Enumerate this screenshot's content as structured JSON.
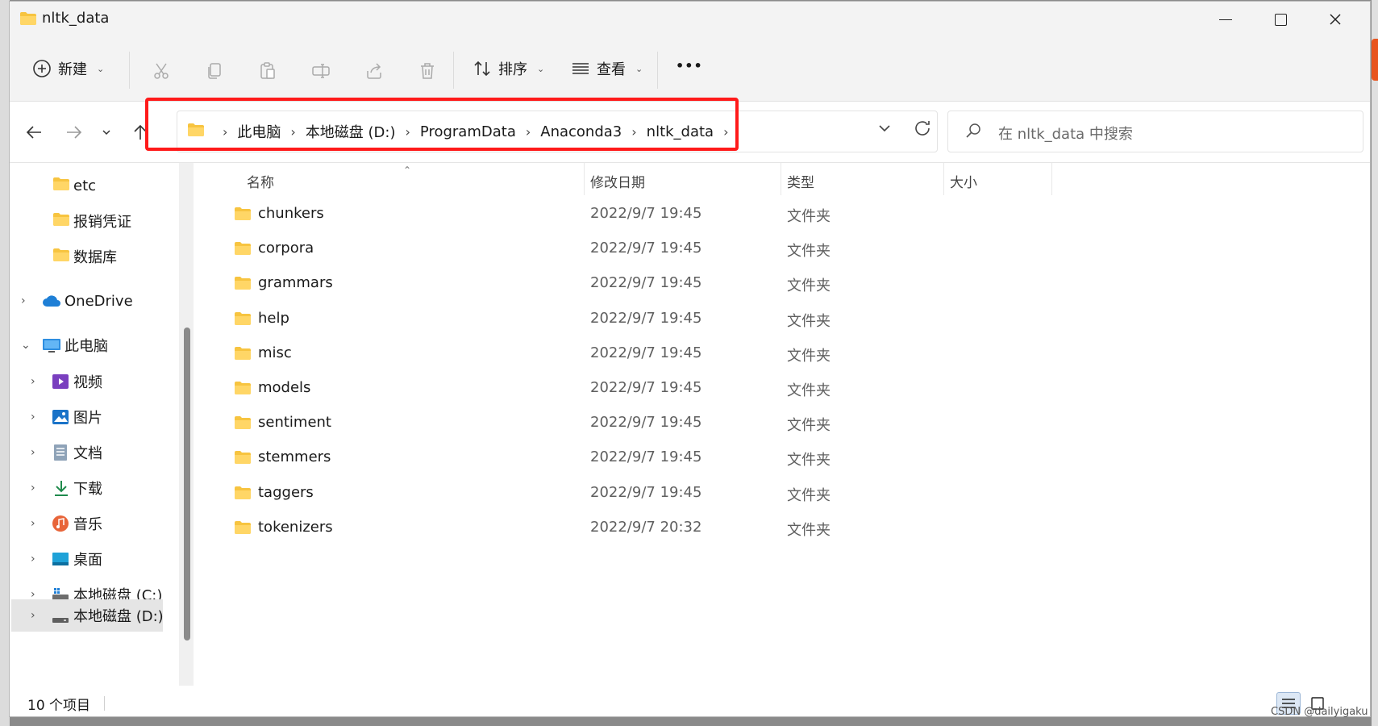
{
  "window": {
    "title": "nltk_data"
  },
  "toolbar": {
    "new_label": "新建",
    "sort_label": "排序",
    "view_label": "查看",
    "more_label": "•••"
  },
  "address": {
    "segments": [
      "此电脑",
      "本地磁盘 (D:)",
      "ProgramData",
      "Anaconda3",
      "nltk_data"
    ]
  },
  "search": {
    "placeholder": "在 nltk_data 中搜索"
  },
  "sidebar": {
    "items": [
      {
        "label": "etc"
      },
      {
        "label": "报销凭证"
      },
      {
        "label": "数据库"
      },
      {
        "label": "OneDrive"
      },
      {
        "label": "此电脑"
      },
      {
        "label": "视频"
      },
      {
        "label": "图片"
      },
      {
        "label": "文档"
      },
      {
        "label": "下载"
      },
      {
        "label": "音乐"
      },
      {
        "label": "桌面"
      },
      {
        "label": "本地磁盘 (C:)"
      },
      {
        "label": "本地磁盘 (D:)"
      }
    ]
  },
  "columns": {
    "name": "名称",
    "date": "修改日期",
    "type": "类型",
    "size": "大小"
  },
  "files": [
    {
      "name": "chunkers",
      "date": "2022/9/7 19:45",
      "type": "文件夹"
    },
    {
      "name": "corpora",
      "date": "2022/9/7 19:45",
      "type": "文件夹"
    },
    {
      "name": "grammars",
      "date": "2022/9/7 19:45",
      "type": "文件夹"
    },
    {
      "name": "help",
      "date": "2022/9/7 19:45",
      "type": "文件夹"
    },
    {
      "name": "misc",
      "date": "2022/9/7 19:45",
      "type": "文件夹"
    },
    {
      "name": "models",
      "date": "2022/9/7 19:45",
      "type": "文件夹"
    },
    {
      "name": "sentiment",
      "date": "2022/9/7 19:45",
      "type": "文件夹"
    },
    {
      "name": "stemmers",
      "date": "2022/9/7 19:45",
      "type": "文件夹"
    },
    {
      "name": "taggers",
      "date": "2022/9/7 19:45",
      "type": "文件夹"
    },
    {
      "name": "tokenizers",
      "date": "2022/9/7 20:32",
      "type": "文件夹"
    }
  ],
  "status": {
    "count": "10 个项目"
  },
  "watermark": "CSDN @dailyigaku",
  "colors": {
    "folder": "#f7c440",
    "highlight": "#ff1a1a",
    "accent": "#0067c0"
  }
}
